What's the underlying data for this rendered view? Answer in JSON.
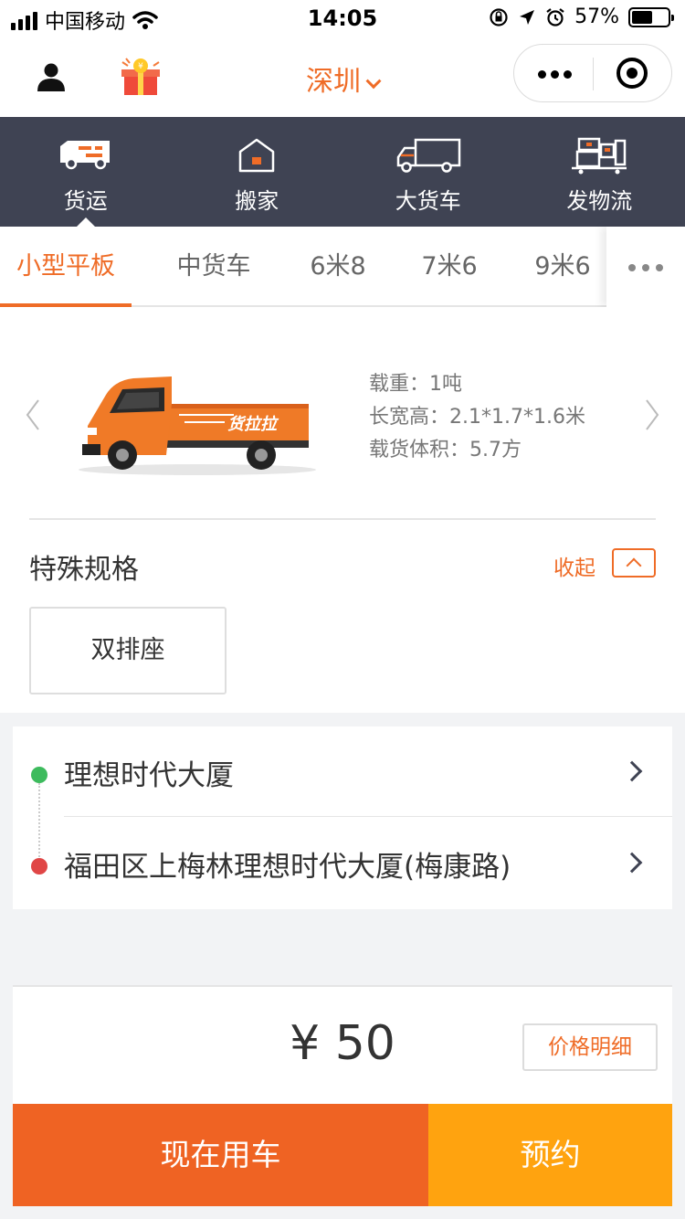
{
  "status_bar": {
    "carrier": "中国移动",
    "time": "14:05",
    "battery_percent": "57%",
    "battery_level": 0.57,
    "icons": [
      "signal-icon",
      "wifi-icon",
      "rotation-lock-icon",
      "location-icon",
      "alarm-icon",
      "battery-icon"
    ]
  },
  "header": {
    "city": "深圳",
    "icons": [
      "user-icon",
      "gift-icon",
      "more-icon",
      "target-icon"
    ]
  },
  "services": [
    {
      "label": "货运",
      "icon": "van-icon",
      "active": true
    },
    {
      "label": "搬家",
      "icon": "house-icon",
      "active": false
    },
    {
      "label": "大货车",
      "icon": "truck-icon",
      "active": false
    },
    {
      "label": "发物流",
      "icon": "logistics-icon",
      "active": false
    }
  ],
  "vehicle_tabs": [
    {
      "label": "小型平板",
      "active": true
    },
    {
      "label": "中货车",
      "active": false
    },
    {
      "label": "6米8",
      "active": false
    },
    {
      "label": "7米6",
      "active": false
    },
    {
      "label": "9米6",
      "active": false
    }
  ],
  "vehicle": {
    "brand_text": "货拉拉",
    "specs": [
      "载重：1吨",
      "长宽高：2.1*1.7*1.6米",
      "载货体积：5.7方"
    ]
  },
  "special": {
    "title": "特殊规格",
    "collapse_label": "收起",
    "options": [
      "双排座"
    ]
  },
  "addresses": {
    "start": "理想时代大厦",
    "end": "福田区上梅林理想时代大厦(梅康路)"
  },
  "pricing": {
    "price": "¥ 50",
    "detail_label": "价格明细"
  },
  "actions": {
    "now_label": "现在用车",
    "reserve_label": "预约"
  },
  "colors": {
    "accent": "#ef6c27",
    "nav_bg": "#3f4353",
    "reserve": "#ffa30f",
    "start_dot": "#3dbb5d",
    "end_dot": "#e04646"
  }
}
